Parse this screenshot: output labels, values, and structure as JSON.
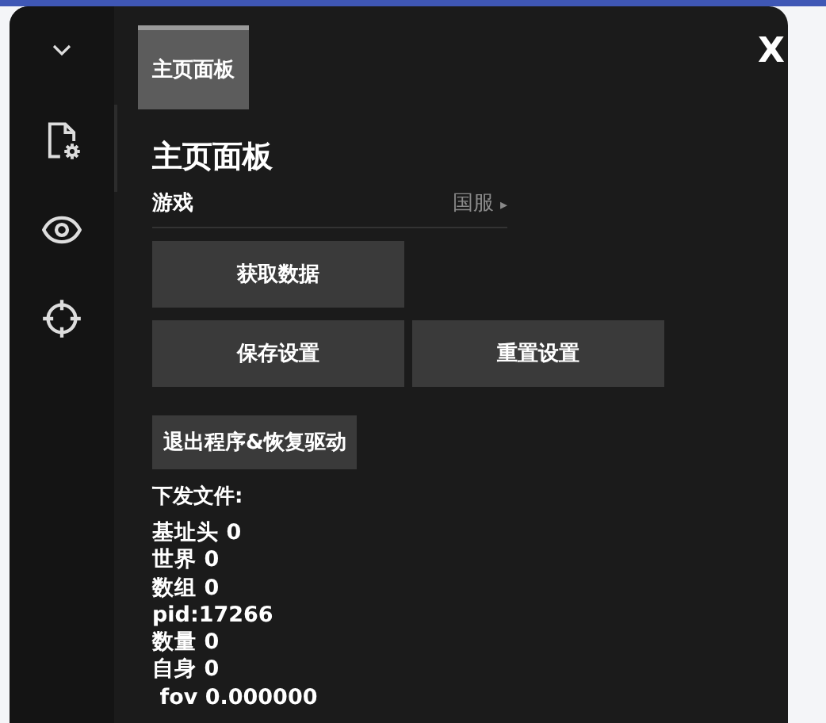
{
  "tabs": [
    {
      "label": "主页面板",
      "selected": true
    }
  ],
  "close": "X",
  "heading": "主页面板",
  "game_select": {
    "label": "游戏",
    "value": "国服",
    "arrow": "▸"
  },
  "button_rows": [
    [
      "获取数据"
    ],
    [
      "保存设置",
      "重置设置"
    ]
  ],
  "exit_button": "退出程序&恢复驱动",
  "section_label": "下发文件:",
  "info_lines": [
    "基址头 0",
    "世界 0",
    "数组 0",
    "pid:17266",
    "数量 0",
    "自身 0",
    " fov 0.000000"
  ]
}
